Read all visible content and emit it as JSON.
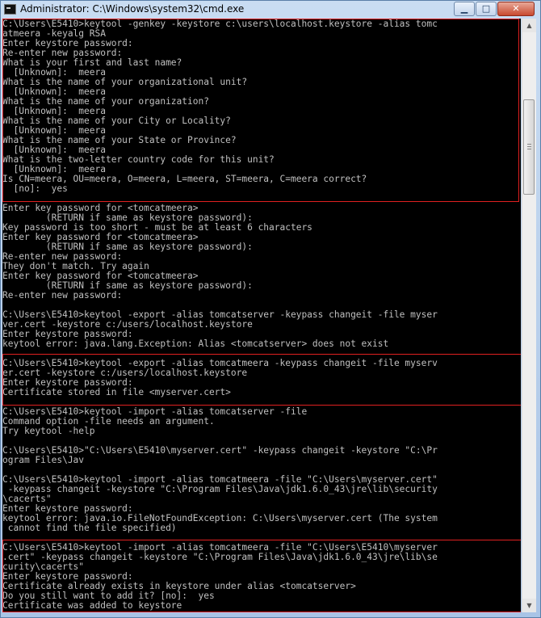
{
  "window": {
    "title": "Administrator: C:\\Windows\\system32\\cmd.exe",
    "controls": {
      "minimize": "▁",
      "maximize": "□",
      "close": "✕"
    }
  },
  "console": {
    "lines": [
      "C:\\Users\\E5410>keytool -genkey -keystore c:\\users\\localhost.keystore -alias tomc",
      "atmeera -keyalg RSA",
      "Enter keystore password:",
      "Re-enter new password:",
      "What is your first and last name?",
      "  [Unknown]:  meera",
      "What is the name of your organizational unit?",
      "  [Unknown]:  meera",
      "What is the name of your organization?",
      "  [Unknown]:  meera",
      "What is the name of your City or Locality?",
      "  [Unknown]:  meera",
      "What is the name of your State or Province?",
      "  [Unknown]:  meera",
      "What is the two-letter country code for this unit?",
      "  [Unknown]:  meera",
      "Is CN=meera, OU=meera, O=meera, L=meera, ST=meera, C=meera correct?",
      "  [no]:  yes",
      "",
      "Enter key password for <tomcatmeera>",
      "        (RETURN if same as keystore password):",
      "Key password is too short - must be at least 6 characters",
      "Enter key password for <tomcatmeera>",
      "        (RETURN if same as keystore password):",
      "Re-enter new password:",
      "They don't match. Try again",
      "Enter key password for <tomcatmeera>",
      "        (RETURN if same as keystore password):",
      "Re-enter new password:",
      "",
      "C:\\Users\\E5410>keytool -export -alias tomcatserver -keypass changeit -file myser",
      "ver.cert -keystore c:/users/localhost.keystore",
      "Enter keystore password:",
      "keytool error: java.lang.Exception: Alias <tomcatserver> does not exist",
      "",
      "C:\\Users\\E5410>keytool -export -alias tomcatmeera -keypass changeit -file myserv",
      "er.cert -keystore c:/users/localhost.keystore",
      "Enter keystore password:",
      "Certificate stored in file <myserver.cert>",
      "",
      "C:\\Users\\E5410>keytool -import -alias tomcatserver -file",
      "Command option -file needs an argument.",
      "Try keytool -help",
      "",
      "C:\\Users\\E5410>\"C:\\Users\\E5410\\myserver.cert\" -keypass changeit -keystore \"C:\\Pr",
      "ogram Files\\Jav",
      "",
      "C:\\Users\\E5410>keytool -import -alias tomcatmeera -file \"C:\\Users\\myserver.cert\"",
      " -keypass changeit -keystore \"C:\\Program Files\\Java\\jdk1.6.0_43\\jre\\lib\\security",
      "\\cacerts\"",
      "Enter keystore password:",
      "keytool error: java.io.FileNotFoundException: C:\\Users\\myserver.cert (The system",
      " cannot find the file specified)",
      "",
      "C:\\Users\\E5410>keytool -import -alias tomcatmeera -file \"C:\\Users\\E5410\\myserver",
      ".cert\" -keypass changeit -keystore \"C:\\Program Files\\Java\\jdk1.6.0_43\\jre\\lib\\se",
      "curity\\cacerts\"",
      "Enter keystore password:",
      "Certificate already exists in keystore under alias <tomcatserver>",
      "Do you still want to add it? [no]:  yes",
      "Certificate was added to keystore"
    ]
  },
  "highlight_color": "#e02020",
  "scrollbar": {
    "up": "▲",
    "down": "▼"
  }
}
